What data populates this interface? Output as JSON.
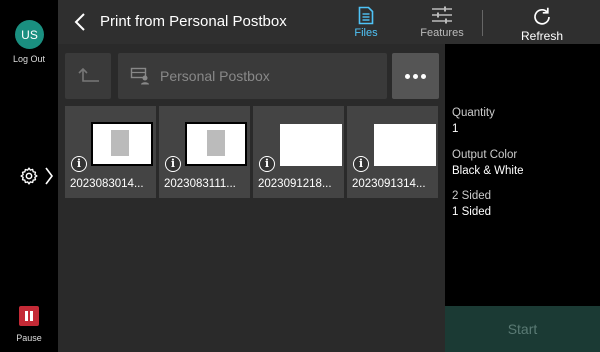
{
  "user": {
    "initials": "US",
    "logout_label": "Log Out"
  },
  "rail": {
    "pause_label": "Pause"
  },
  "header": {
    "title": "Print from Personal Postbox",
    "files_label": "Files",
    "features_label": "Features",
    "refresh_label": "Refresh"
  },
  "path": {
    "location": "Personal Postbox"
  },
  "files": [
    {
      "name": "2023083014..."
    },
    {
      "name": "2023083111..."
    },
    {
      "name": "2023091218..."
    },
    {
      "name": "2023091314..."
    }
  ],
  "settings": {
    "quantity_label": "Quantity",
    "quantity_value": "1",
    "color_label": "Output Color",
    "color_value": "Black & White",
    "sided_label": "2 Sided",
    "sided_value": "1 Sided"
  },
  "start_label": "Start",
  "colors": {
    "accent": "#4fc3f7",
    "avatar": "#1a8f80",
    "pause": "#c42a36",
    "start_bg": "#1b3a34"
  }
}
